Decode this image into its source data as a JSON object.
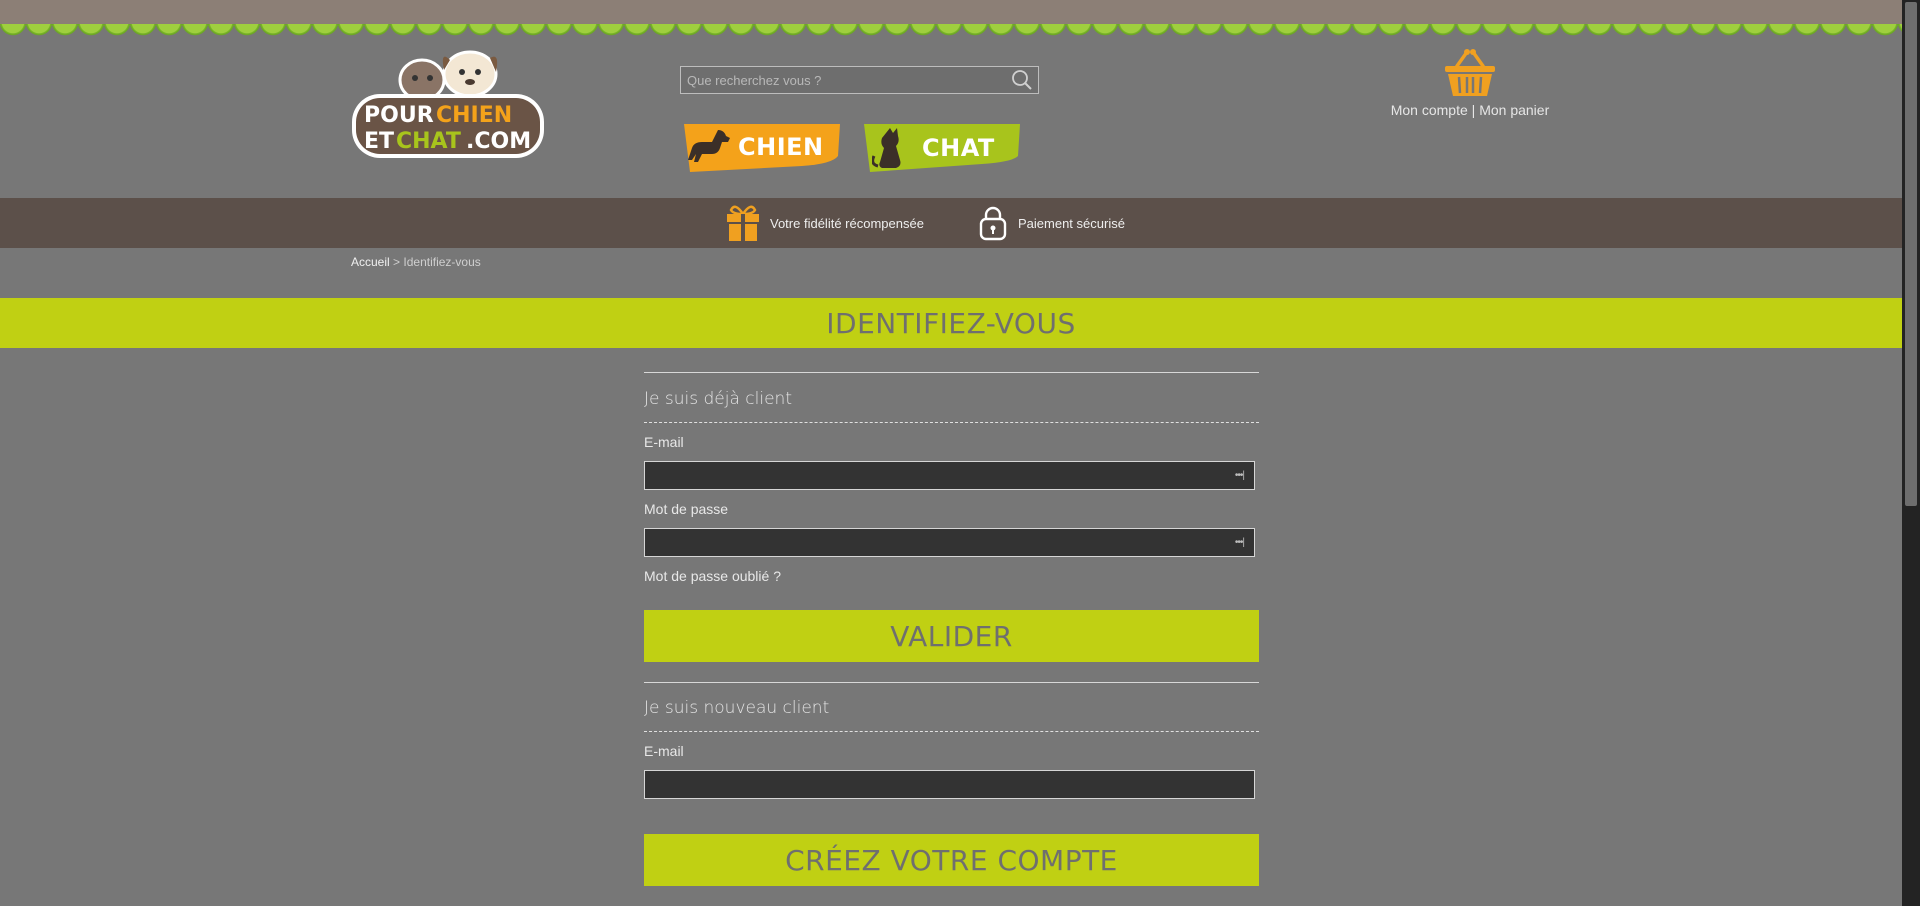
{
  "colors": {
    "accent_green": "#c0d013",
    "dog_orange": "#f4a21a",
    "cat_green": "#a8c41c",
    "basket_orange": "#f0a020",
    "info_bar": "#5c504a"
  },
  "logo": {
    "brand_text": "pourchienetchat.com",
    "icon": "dog-cat-logo"
  },
  "header": {
    "search": {
      "placeholder": "Que recherchez vous ?",
      "icon": "search-icon"
    },
    "nav": [
      {
        "label": "CHIEN",
        "icon": "dog-icon"
      },
      {
        "label": "CHAT",
        "icon": "cat-icon"
      }
    ],
    "account": {
      "icon": "basket-icon",
      "account_label": "Mon compte",
      "separator": "|",
      "cart_label": "Mon panier"
    }
  },
  "infobar": {
    "items": [
      {
        "label": "Votre fidélité récompensée",
        "icon": "gift-icon"
      },
      {
        "label": "Paiement sécurisé",
        "icon": "lock-icon"
      }
    ]
  },
  "breadcrumb": {
    "home": "Accueil",
    "separator": ">",
    "current": "Identifiez-vous"
  },
  "page_title": "IDENTIFIEZ-VOUS",
  "existing_client": {
    "title": "Je suis déjà client",
    "email_label": "E-mail",
    "email_value": "",
    "password_label": "Mot de passe",
    "password_value": "",
    "forgot_label": "Mot de passe oublié ?",
    "submit_label": "VALIDER"
  },
  "new_client": {
    "title": "Je suis nouveau client",
    "email_label": "E-mail",
    "email_value": "",
    "submit_label": "CRÉEZ VOTRE COMPTE"
  }
}
